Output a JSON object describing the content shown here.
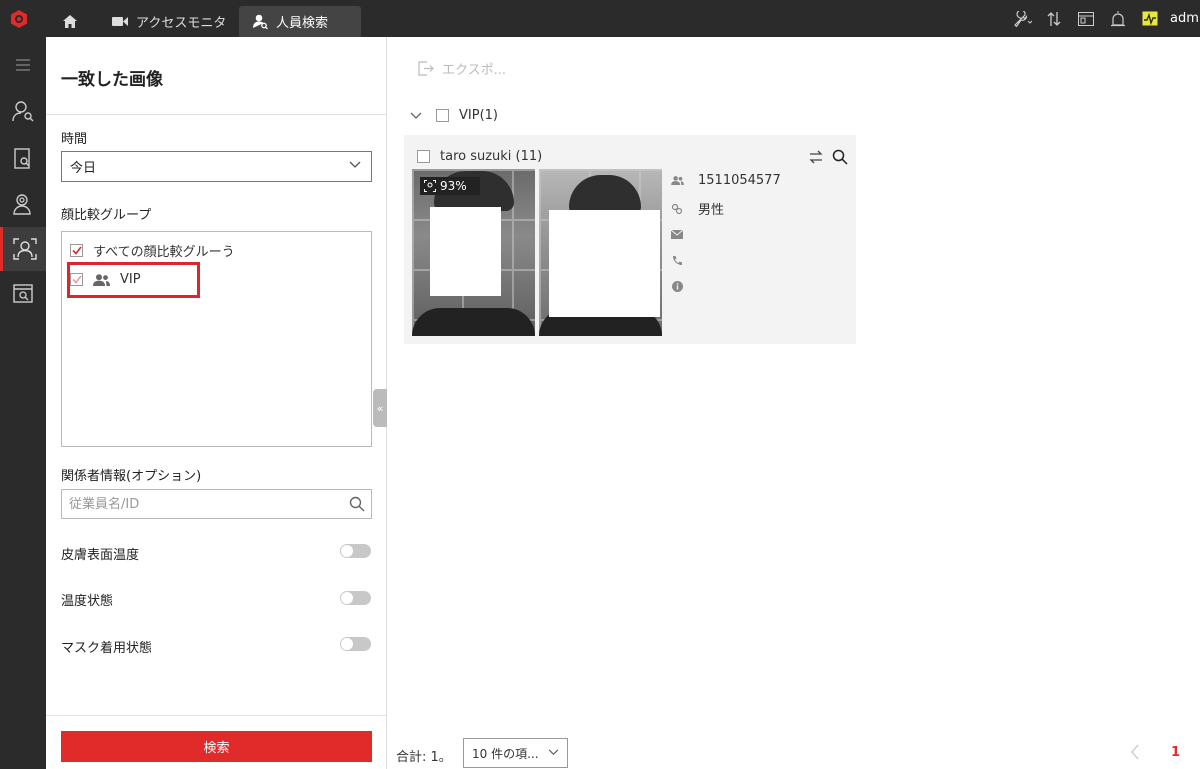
{
  "topbar": {
    "tabs": [
      {
        "label": "アクセスモニタ"
      },
      {
        "label": "人員検索"
      }
    ],
    "user": "admin"
  },
  "left_panel": {
    "title": "一致した画像",
    "time_label": "時間",
    "time_value": "今日",
    "group_label": "顔比較グループ",
    "groups": [
      {
        "label": "すべての顔比較グルーう",
        "checked": true
      },
      {
        "label": "VIP",
        "checked": true
      }
    ],
    "person_label": "関係者情報(オプション)",
    "person_placeholder": "従業員名/ID",
    "toggles": [
      {
        "label": "皮膚表面温度",
        "on": false
      },
      {
        "label": "温度状態",
        "on": false
      },
      {
        "label": "マスク着用状態",
        "on": false
      }
    ],
    "search_button": "検索"
  },
  "main": {
    "export_label": "エクスポ...",
    "group_header": "VIP(1)",
    "result": {
      "name": "taro suzuki (11)",
      "similarity": "93%",
      "id": "1511054577",
      "gender": "男性"
    },
    "footer": {
      "total": "合計: 1。",
      "page_size": "10 件の項...",
      "current_page": "1"
    }
  },
  "colors": {
    "accent": "#e12a2a",
    "topbar": "#2b2b2b"
  }
}
